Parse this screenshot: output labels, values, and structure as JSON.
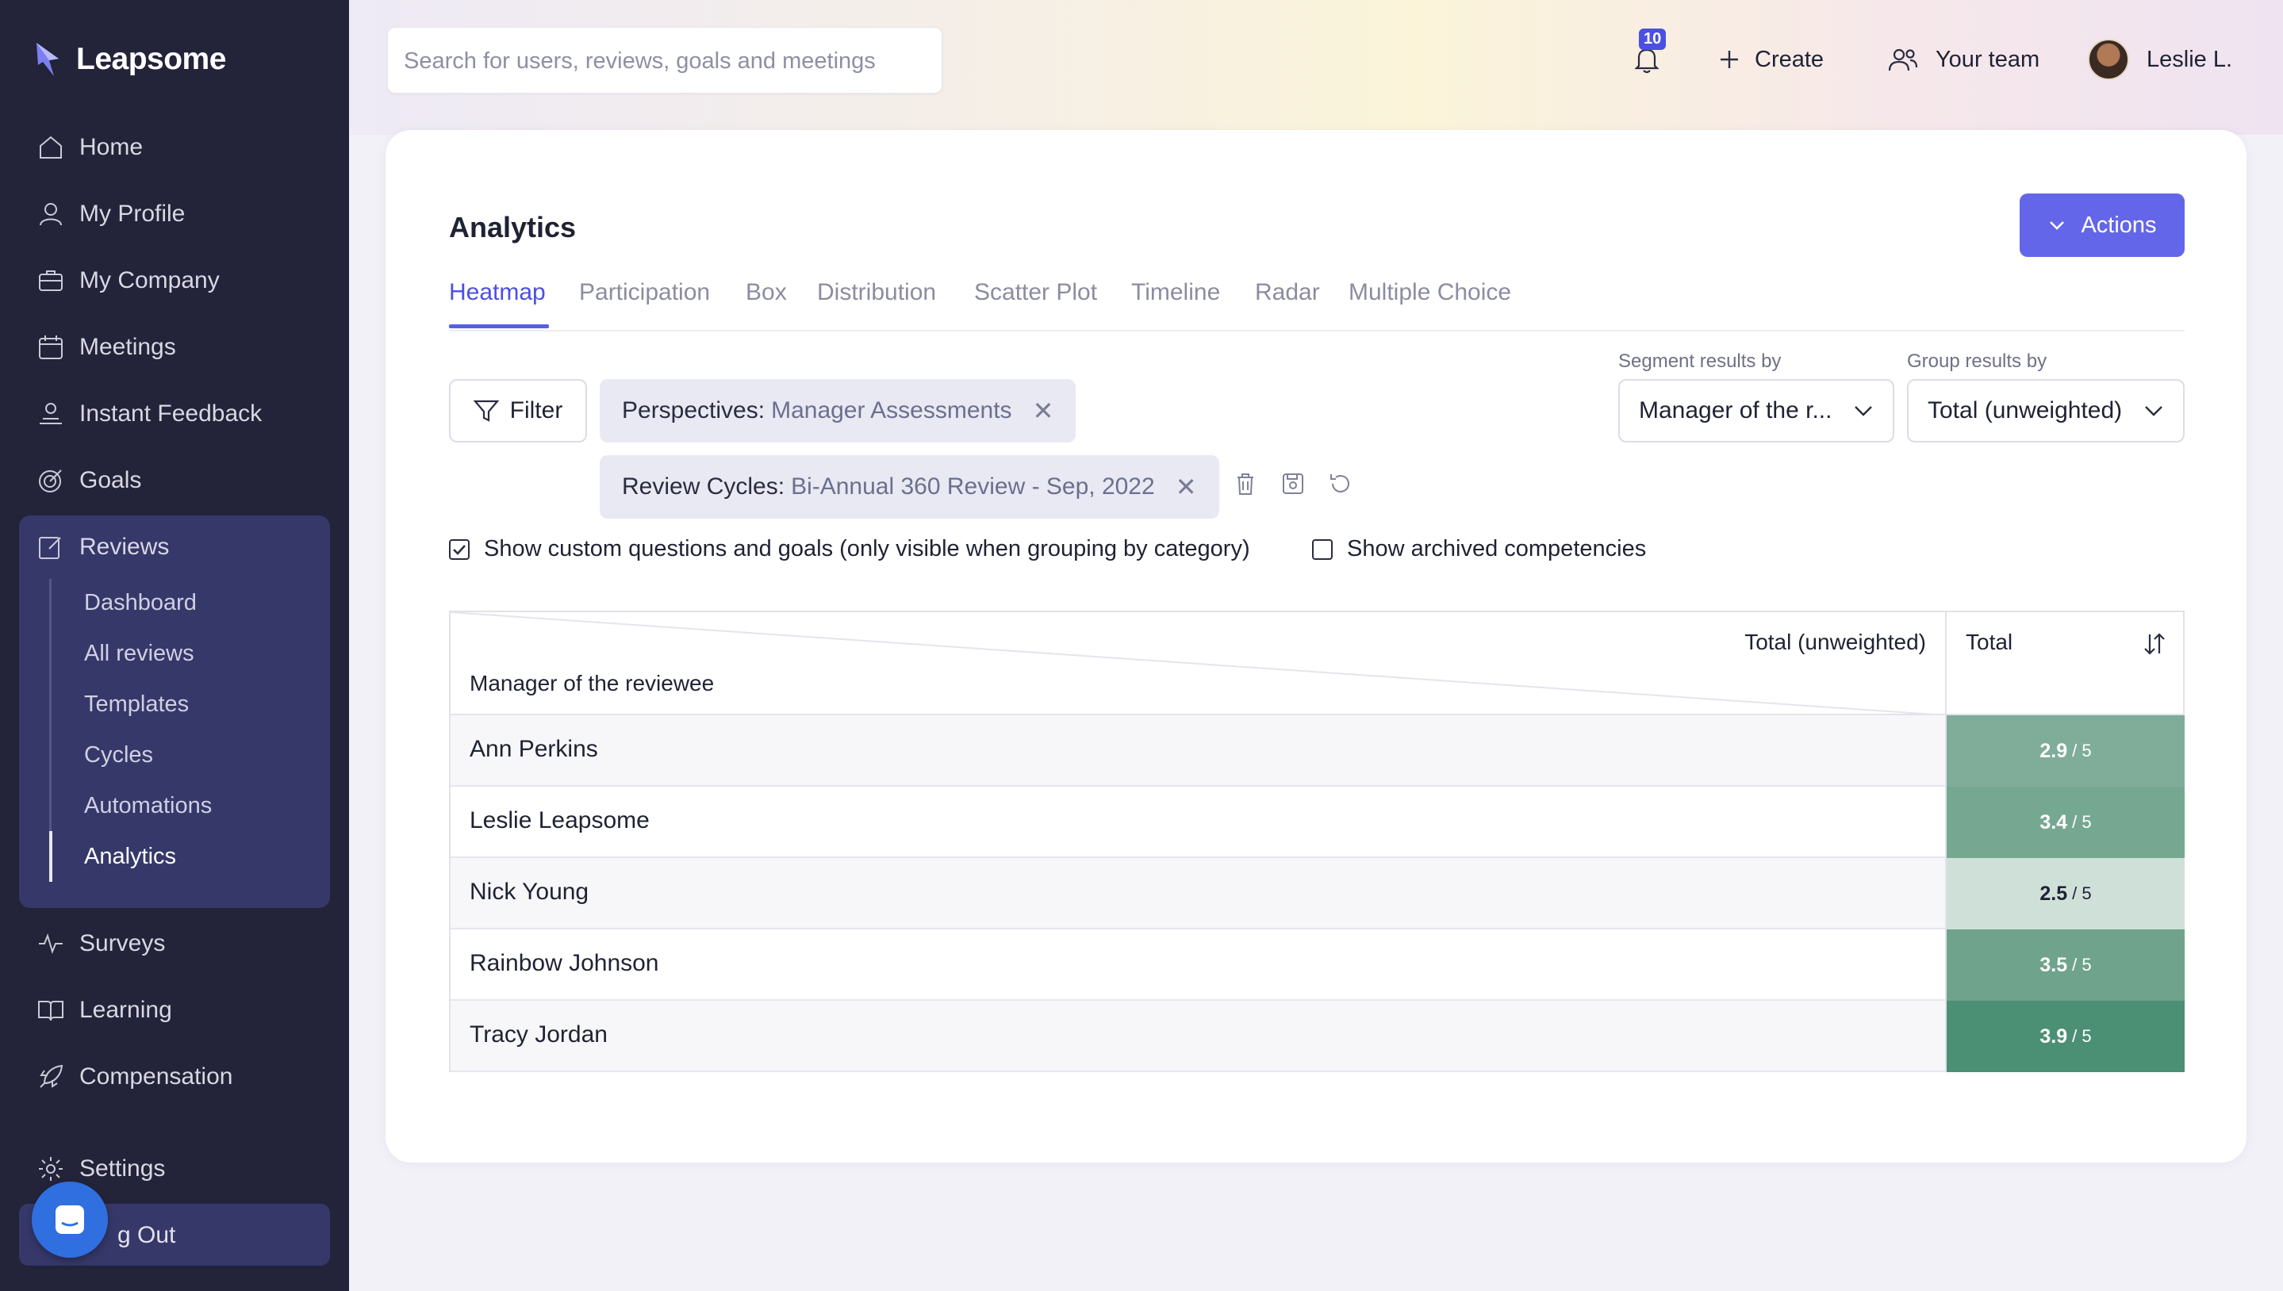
{
  "app": {
    "name": "Leapsome"
  },
  "sidebar": {
    "items": [
      {
        "label": "Home",
        "icon": "home-icon"
      },
      {
        "label": "My Profile",
        "icon": "user-icon"
      },
      {
        "label": "My Company",
        "icon": "briefcase-icon"
      },
      {
        "label": "Meetings",
        "icon": "calendar-icon"
      },
      {
        "label": "Instant Feedback",
        "icon": "feedback-icon"
      },
      {
        "label": "Goals",
        "icon": "target-icon"
      },
      {
        "label": "Reviews",
        "icon": "edit-icon"
      },
      {
        "label": "Surveys",
        "icon": "pulse-icon"
      },
      {
        "label": "Learning",
        "icon": "book-icon"
      },
      {
        "label": "Compensation",
        "icon": "rocket-icon"
      },
      {
        "label": "Settings",
        "icon": "gear-icon"
      }
    ],
    "review_sub": [
      "Dashboard",
      "All reviews",
      "Templates",
      "Cycles",
      "Automations",
      "Analytics"
    ],
    "logout_label": "g Out"
  },
  "topbar": {
    "search_placeholder": "Search for users, reviews, goals and meetings",
    "notification_count": "10",
    "create_label": "Create",
    "team_label": "Your team",
    "user_name": "Leslie L."
  },
  "page": {
    "title": "Analytics",
    "actions_label": "Actions",
    "tabs": [
      "Heatmap",
      "Participation",
      "Box",
      "Distribution",
      "Scatter Plot",
      "Timeline",
      "Radar",
      "Multiple Choice"
    ],
    "filter_label": "Filter",
    "chips": [
      {
        "key": "Perspectives:",
        "value": "Manager Assessments"
      },
      {
        "key": "Review Cycles:",
        "value": "Bi-Annual 360 Review - Sep, 2022"
      }
    ],
    "segment_label": "Segment results by",
    "segment_value": "Manager of the r...",
    "group_label": "Group results by",
    "group_value": "Total (unweighted)",
    "checkbox_custom": "Show custom questions and goals (only visible when grouping by category)",
    "checkbox_archived": "Show archived competencies"
  },
  "table": {
    "corner_top": "Total (unweighted)",
    "corner_bottom": "Manager of the reviewee",
    "col_header": "Total",
    "rows": [
      {
        "name": "Ann Perkins",
        "score": "2.9",
        "max": "/ 5",
        "color": "#7fad9a"
      },
      {
        "name": "Leslie Leapsome",
        "score": "3.4",
        "max": "/ 5",
        "color": "#76a891"
      },
      {
        "name": "Nick Young",
        "score": "2.5",
        "max": "/ 5",
        "color": "#cfe0d8"
      },
      {
        "name": "Rainbow Johnson",
        "score": "3.5",
        "max": "/ 5",
        "color": "#6fa38b"
      },
      {
        "name": "Tracy Jordan",
        "score": "3.9",
        "max": "/ 5",
        "color": "#4b8f74"
      }
    ]
  }
}
